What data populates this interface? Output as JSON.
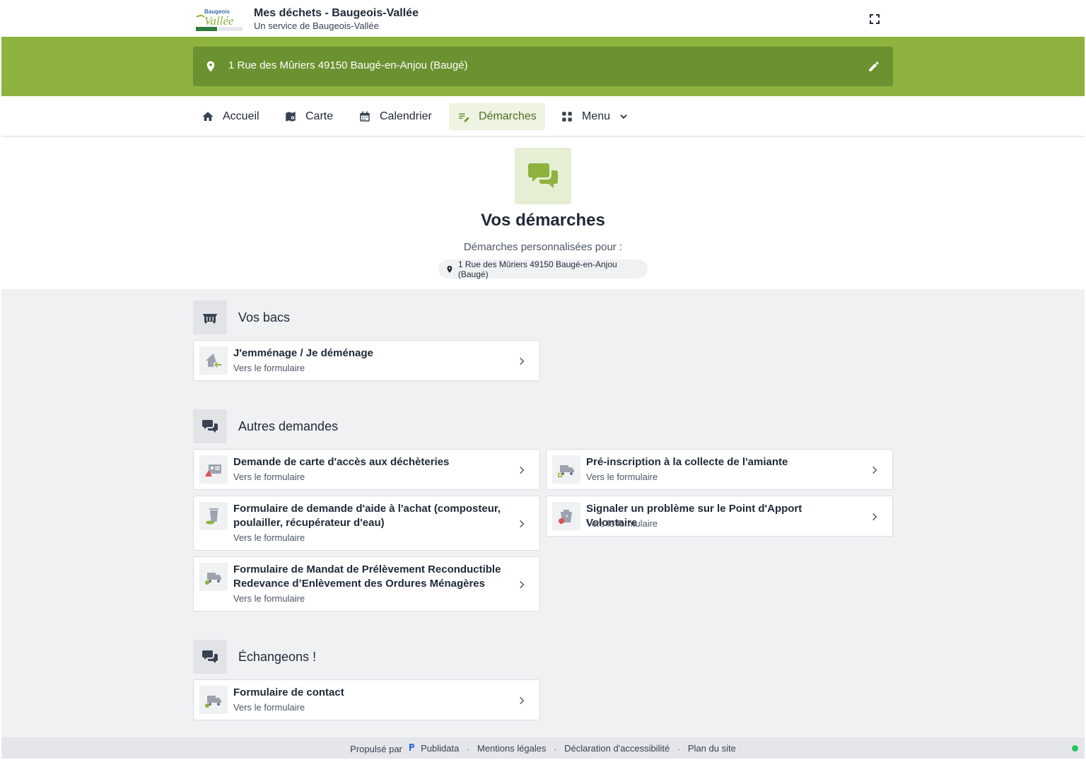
{
  "header": {
    "logo_text": "Baugeois Vallée",
    "app_title": "Mes déchets - Baugeois-Vallée",
    "app_subtitle": "Un service de Baugeois-Vallée"
  },
  "address": {
    "text": "1 Rue des Mûriers 49150 Baugé-en-Anjou (Baugé)"
  },
  "nav": {
    "items": [
      {
        "label": "Accueil",
        "icon": "home-icon"
      },
      {
        "label": "Carte",
        "icon": "map-icon"
      },
      {
        "label": "Calendrier",
        "icon": "calendar-icon"
      },
      {
        "label": "Démarches",
        "icon": "edit-note-icon",
        "active": true
      },
      {
        "label": "Menu",
        "icon": "grid-icon"
      }
    ]
  },
  "hero": {
    "title": "Vos démarches",
    "subtitle": "Démarches personnalisées pour :",
    "address_chip": "1 Rue des Mûriers 49150 Baugé-en-Anjou (Baugé)"
  },
  "sections": [
    {
      "title": "Vos bacs",
      "icon": "bin-icon",
      "cards": [
        {
          "title": "J'emménage / Je déménage",
          "link": "Vers le formulaire",
          "icon": "house-move-icon"
        }
      ]
    },
    {
      "title": "Autres demandes",
      "icon": "chat-icon",
      "cards": [
        {
          "title": "Demande de carte d'accès aux déchèteries",
          "link": "Vers le formulaire",
          "icon": "id-card-icon"
        },
        {
          "title": "Pré-inscription à la collecte de l'amiante",
          "link": "Vers le formulaire",
          "icon": "truck-icon"
        },
        {
          "title": "Formulaire de demande d'aide à l'achat (composteur, poulailler, récupérateur d'eau)",
          "link": "Vers le formulaire",
          "icon": "compost-bin-icon"
        },
        {
          "title": "Signaler un problème sur le Point d'Apport Volontaire",
          "link": "Vers le formulaire",
          "icon": "container-alert-icon"
        },
        {
          "title": "Formulaire de Mandat de Prélèvement Reconductible Redevance d’Enlèvement des Ordures Ménagères",
          "link": "Vers le formulaire",
          "icon": "truck-icon"
        }
      ]
    },
    {
      "title": "Échangeons !",
      "icon": "chat-icon",
      "cards": [
        {
          "title": "Formulaire de contact",
          "link": "Vers le formulaire",
          "icon": "truck-icon"
        }
      ]
    }
  ],
  "footer": {
    "powered_by": "Propulsé par",
    "brand": "Publidata",
    "links": [
      "Mentions légales",
      "Déclaration d'accessibilité",
      "Plan du site"
    ]
  },
  "colors": {
    "brand_green": "#8db33e",
    "address_bar": "#6b9130",
    "active_tab_bg": "#eef3e2",
    "status_ok": "#22c55e"
  }
}
